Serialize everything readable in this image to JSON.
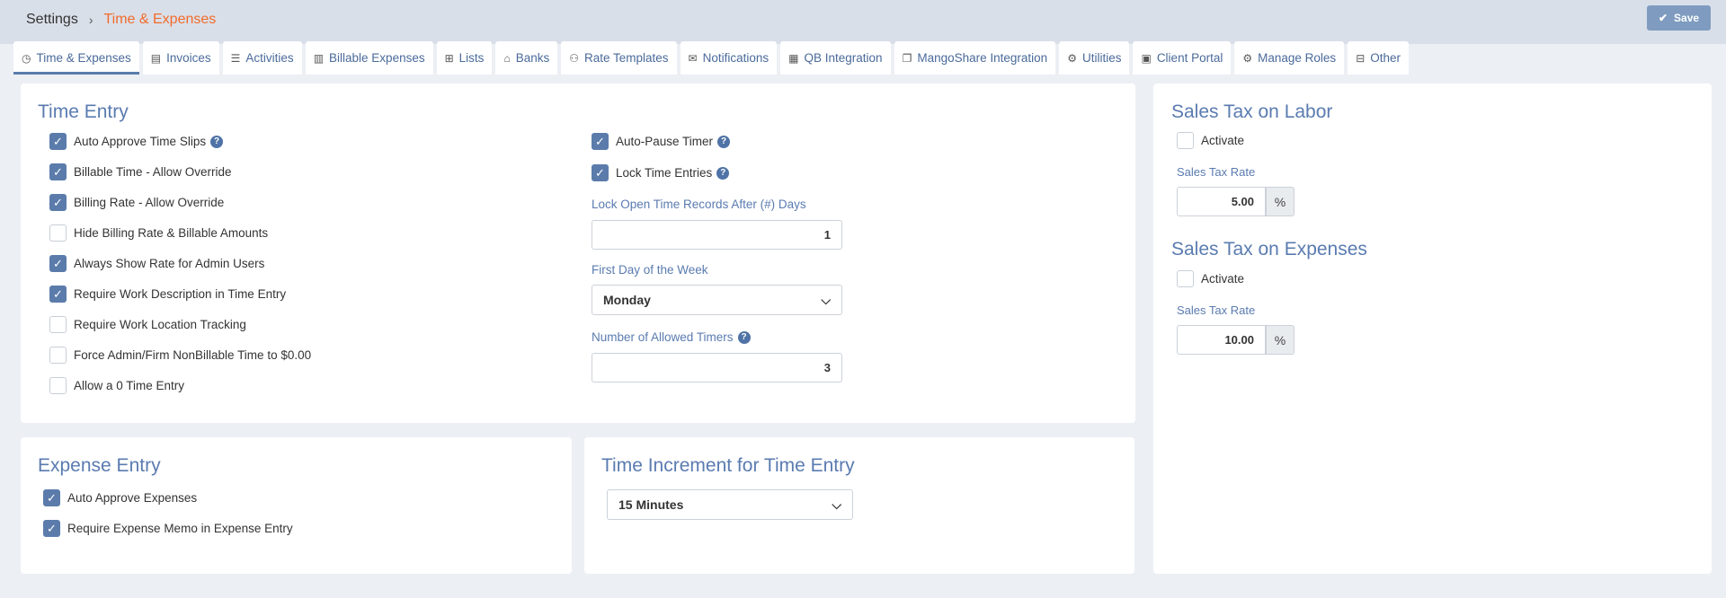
{
  "breadcrumb": {
    "root": "Settings",
    "separator": "›",
    "current": "Time & Expenses"
  },
  "toolbar": {
    "save_label": "Save"
  },
  "colors": {
    "accent": "#5b7cab",
    "breadcrumb_active": "#f26b2a",
    "save_button": "#7f9cc0"
  },
  "tabs": [
    {
      "label": "Time & Expenses",
      "icon": "clock-icon",
      "active": true
    },
    {
      "label": "Invoices",
      "icon": "invoice-icon"
    },
    {
      "label": "Activities",
      "icon": "list-icon"
    },
    {
      "label": "Billable Expenses",
      "icon": "receipt-icon"
    },
    {
      "label": "Lists",
      "icon": "table-icon"
    },
    {
      "label": "Banks",
      "icon": "bank-icon"
    },
    {
      "label": "Rate Templates",
      "icon": "users-icon"
    },
    {
      "label": "Notifications",
      "icon": "envelope-icon"
    },
    {
      "label": "QB Integration",
      "icon": "qb-icon"
    },
    {
      "label": "MangoShare Integration",
      "icon": "folder-icon"
    },
    {
      "label": "Utilities",
      "icon": "cogs-icon"
    },
    {
      "label": "Client Portal",
      "icon": "portal-icon"
    },
    {
      "label": "Manage Roles",
      "icon": "roles-icon"
    },
    {
      "label": "Other",
      "icon": "grid-icon"
    }
  ],
  "time_entry": {
    "title": "Time Entry",
    "options": [
      {
        "label": "Auto Approve Time Slips",
        "checked": true,
        "help": true
      },
      {
        "label": "Billable Time - Allow Override",
        "checked": true
      },
      {
        "label": "Billing Rate - Allow Override",
        "checked": true
      },
      {
        "label": "Hide Billing Rate & Billable Amounts",
        "checked": false
      },
      {
        "label": "Always Show Rate for Admin Users",
        "checked": true
      },
      {
        "label": "Require Work Description in Time Entry",
        "checked": true
      },
      {
        "label": "Require Work Location Tracking",
        "checked": false
      },
      {
        "label": "Force Admin/Firm NonBillable Time to $0.00",
        "checked": false
      },
      {
        "label": "Allow a 0 Time Entry",
        "checked": false
      }
    ],
    "right_options": [
      {
        "label": "Auto-Pause Timer",
        "checked": true,
        "help": true
      },
      {
        "label": "Lock Time Entries",
        "checked": true,
        "help": true
      }
    ],
    "lock_after_label": "Lock Open Time Records After (#) Days",
    "lock_after_value": "1",
    "first_day_label": "First Day of the Week",
    "first_day_value": "Monday",
    "timers_label": "Number of Allowed Timers",
    "timers_value": "3"
  },
  "expense_entry": {
    "title": "Expense Entry",
    "options": [
      {
        "label": "Auto Approve Expenses",
        "checked": true
      },
      {
        "label": "Require Expense Memo in Expense Entry",
        "checked": true
      }
    ]
  },
  "time_increment": {
    "title": "Time Increment for Time Entry",
    "value": "15 Minutes"
  },
  "sales_tax": {
    "labor": {
      "title": "Sales Tax on Labor",
      "activate_label": "Activate",
      "checked": false,
      "rate_label": "Sales Tax Rate",
      "rate": "5.00",
      "unit": "%"
    },
    "expenses": {
      "title": "Sales Tax on Expenses",
      "activate_label": "Activate",
      "checked": false,
      "rate_label": "Sales Tax Rate",
      "rate": "10.00",
      "unit": "%"
    }
  }
}
